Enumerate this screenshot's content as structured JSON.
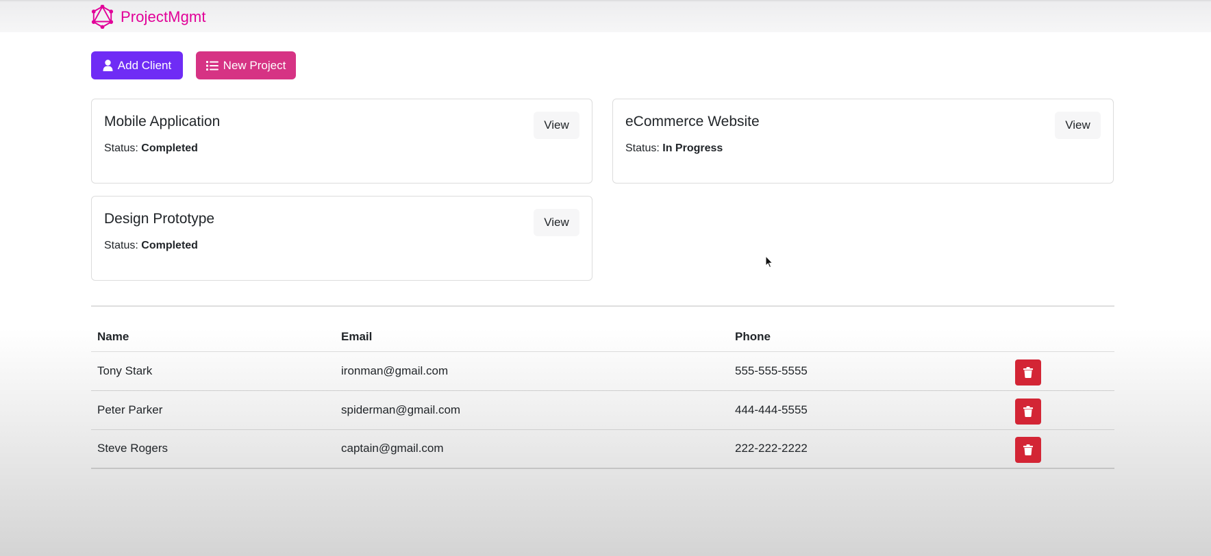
{
  "app": {
    "brand_name": "ProjectMgmt",
    "brand_color": "#e10098",
    "logo_icon": "graphql-logo-icon"
  },
  "actions": {
    "add_client_label": "Add Client",
    "add_client_icon": "user-icon",
    "add_client_color": "#6f2cf5",
    "new_project_label": "New Project",
    "new_project_icon": "list-icon",
    "new_project_color": "#d63384"
  },
  "projects": [
    {
      "title": "Mobile Application",
      "status_label": "Status:",
      "status": "Completed",
      "view_label": "View"
    },
    {
      "title": "eCommerce Website",
      "status_label": "Status:",
      "status": "In Progress",
      "view_label": "View"
    },
    {
      "title": "Design Prototype",
      "status_label": "Status:",
      "status": "Completed",
      "view_label": "View"
    }
  ],
  "clients_table": {
    "headers": {
      "name": "Name",
      "email": "Email",
      "phone": "Phone"
    },
    "rows": [
      {
        "name": "Tony Stark",
        "email": "ironman@gmail.com",
        "phone": "555-555-5555",
        "action_icon": "trash-icon"
      },
      {
        "name": "Peter Parker",
        "email": "spiderman@gmail.com",
        "phone": "444-444-5555",
        "action_icon": "trash-icon"
      },
      {
        "name": "Steve Rogers",
        "email": "captain@gmail.com",
        "phone": "222-222-2222",
        "action_icon": "trash-icon"
      }
    ],
    "delete_color": "#d32535"
  }
}
